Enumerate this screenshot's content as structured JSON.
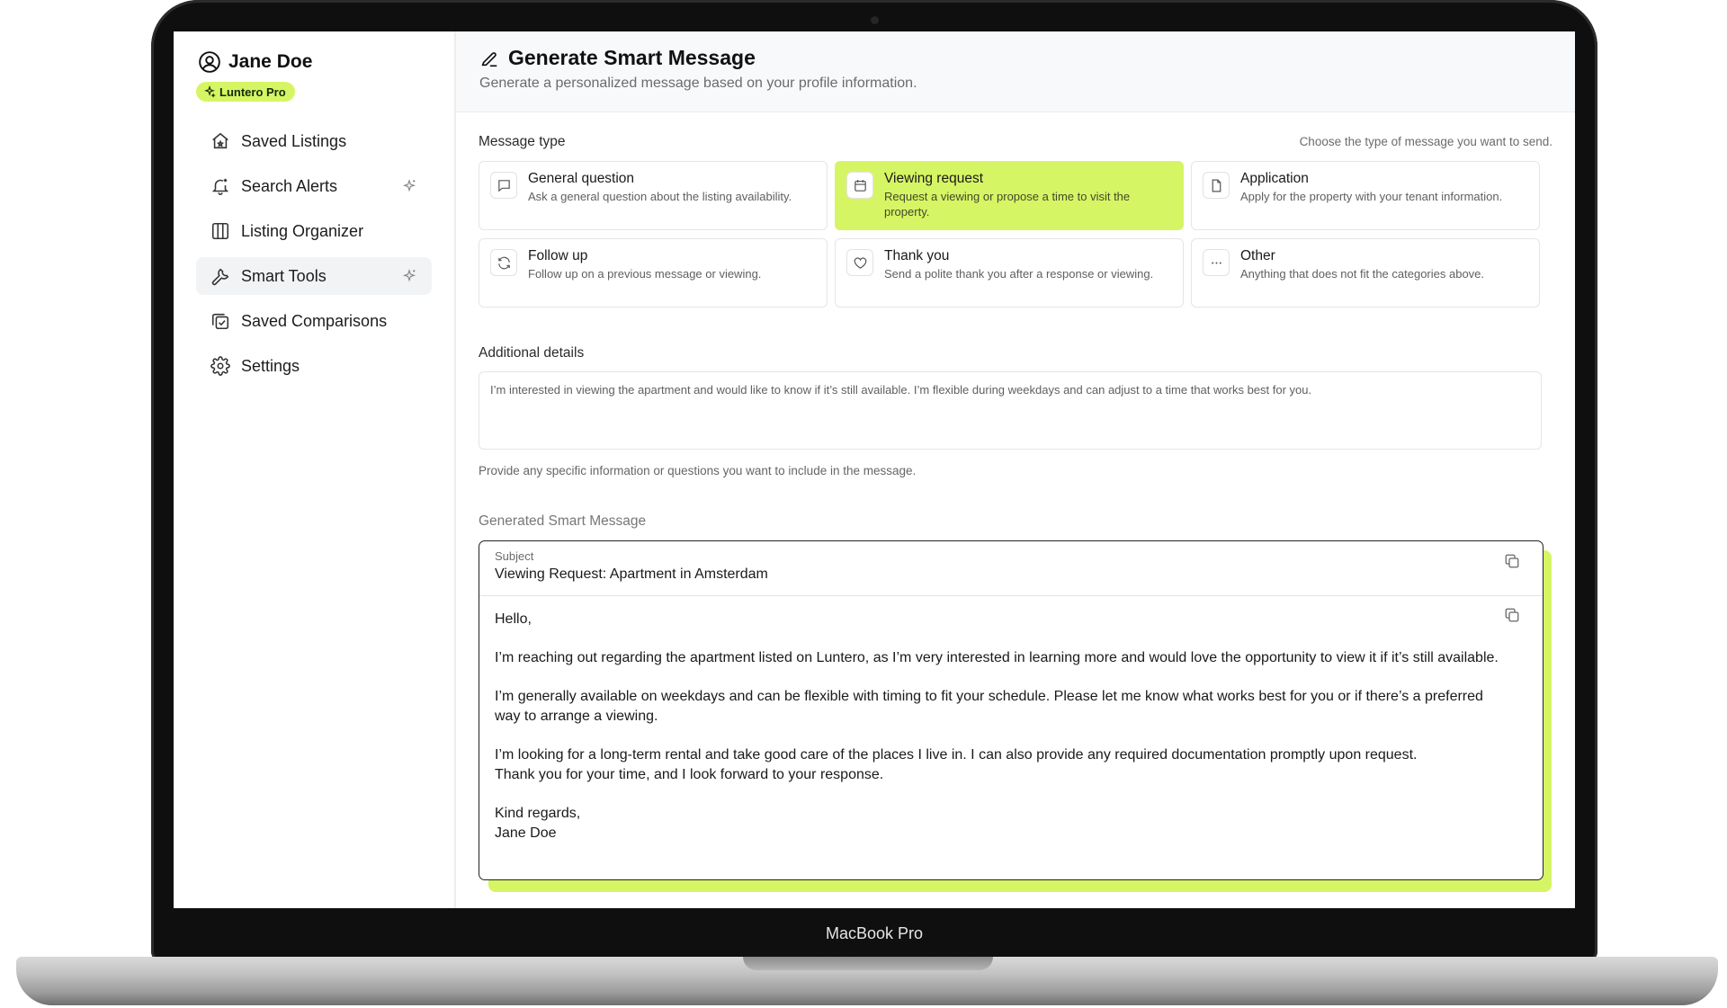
{
  "device": {
    "label": "MacBook Pro"
  },
  "sidebar": {
    "user_name": "Jane Doe",
    "badge": "Luntero Pro",
    "items": [
      {
        "label": "Saved Listings",
        "icon": "house-icon",
        "spark": false,
        "active": false
      },
      {
        "label": "Search Alerts",
        "icon": "bell-icon",
        "spark": true,
        "active": false
      },
      {
        "label": "Listing Organizer",
        "icon": "columns-icon",
        "spark": false,
        "active": false
      },
      {
        "label": "Smart Tools",
        "icon": "wrench-icon",
        "spark": true,
        "active": true
      },
      {
        "label": "Saved Comparisons",
        "icon": "compare-icon",
        "spark": false,
        "active": false
      },
      {
        "label": "Settings",
        "icon": "gear-icon",
        "spark": false,
        "active": false
      }
    ]
  },
  "header": {
    "title": "Generate Smart Message",
    "subtitle": "Generate a personalized message based on your profile information."
  },
  "message_type": {
    "label": "Message type",
    "hint": "Choose the type of message you want to send.",
    "selected": "Viewing request",
    "options": [
      {
        "title": "General question",
        "desc": "Ask a general question about the listing availability.",
        "icon": "chat-icon"
      },
      {
        "title": "Viewing request",
        "desc": "Request a viewing or propose a time to visit the property.",
        "icon": "calendar-icon"
      },
      {
        "title": "Application",
        "desc": "Apply for the property with your tenant information.",
        "icon": "document-icon"
      },
      {
        "title": "Follow up",
        "desc": "Follow up on a previous message or viewing.",
        "icon": "refresh-icon"
      },
      {
        "title": "Thank you",
        "desc": "Send a polite thank you after a response or viewing.",
        "icon": "heart-icon"
      },
      {
        "title": "Other",
        "desc": "Anything that does not fit the categories above.",
        "icon": "more-icon"
      }
    ]
  },
  "details": {
    "label": "Additional details",
    "value": "I’m interested in viewing the apartment and would like to know if it’s still available. I’m flexible during weekdays and can adjust to a time that works best for you.",
    "help": "Provide any specific information or questions you want to include in the message."
  },
  "generated": {
    "label": "Generated Smart Message",
    "subject_label": "Subject",
    "subject": "Viewing Request: Apartment in Amsterdam",
    "greeting": "Hello,",
    "p1": "I’m reaching out regarding the apartment listed on Luntero, as I’m very interested in learning more and would love the opportunity to view it if it’s still available.",
    "p2": "I’m generally available on weekdays and can be flexible with timing to fit your schedule. Please let me know what works best for you or if there’s a preferred way to arrange a viewing.",
    "p3_line1": "I’m looking for a long-term rental and take good care of the places I live in. I can also provide any required documentation promptly upon request.",
    "p3_line2": "Thank you for your time, and I look forward to your response.",
    "closing": "Kind regards,",
    "signature": "Jane Doe"
  },
  "colors": {
    "accent": "#d6f564",
    "border": "#e5e5e5",
    "text": "#1a1a1a"
  }
}
